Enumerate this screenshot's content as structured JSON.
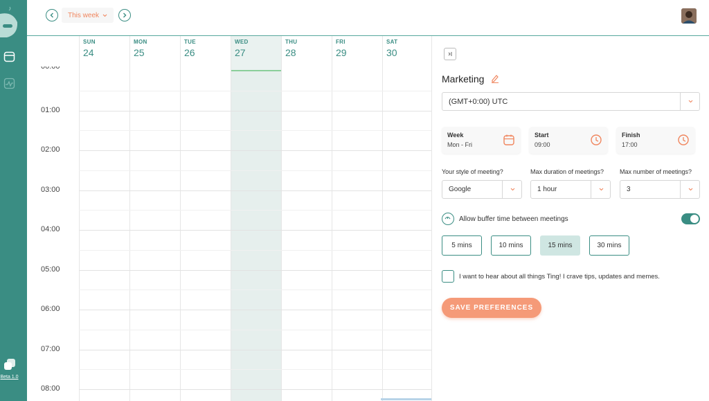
{
  "app": {
    "brand_color": "#3a8d83",
    "accent_color": "#f0855d",
    "version_label": "Beta 1.0"
  },
  "rail": {
    "icons": [
      "mascot-icon",
      "calendar-icon",
      "activity-icon",
      "ting-logo-icon"
    ]
  },
  "topbar": {
    "week_label": "This week",
    "prev_icon": "chevron-left-icon",
    "next_icon": "chevron-right-icon"
  },
  "calendar": {
    "days": [
      {
        "name": "SUN",
        "date": "24"
      },
      {
        "name": "MON",
        "date": "25"
      },
      {
        "name": "TUE",
        "date": "26"
      },
      {
        "name": "WED",
        "date": "27",
        "today": true
      },
      {
        "name": "THU",
        "date": "28"
      },
      {
        "name": "FRI",
        "date": "29"
      },
      {
        "name": "SAT",
        "date": "30"
      }
    ],
    "hours": [
      "00:00",
      "01:00",
      "02:00",
      "03:00",
      "04:00",
      "05:00",
      "06:00",
      "07:00",
      "08:00"
    ]
  },
  "panel": {
    "title": "Marketing",
    "timezone": "(GMT+0:00) UTC",
    "cards": [
      {
        "label": "Week",
        "value": "Mon - Fri",
        "icon": "calendar-icon"
      },
      {
        "label": "Start",
        "value": "09:00",
        "icon": "clock-icon"
      },
      {
        "label": "Finish",
        "value": "17:00",
        "icon": "clock-icon"
      }
    ],
    "fields": [
      {
        "label": "Your style of meeting?",
        "value": "Google"
      },
      {
        "label": "Max duration of meetings?",
        "value": "1 hour"
      },
      {
        "label": "Max number of meetings?",
        "value": "3"
      }
    ],
    "buffer_label": "Allow buffer time between meetings",
    "buffer_enabled": true,
    "buffer_options": [
      "5 mins",
      "10 mins",
      "15 mins",
      "30 mins"
    ],
    "buffer_selected": "15 mins",
    "newsletter_label": "I want to hear about all things Ting! I crave tips, updates and memes.",
    "newsletter_checked": false,
    "save_label": "SAVE PREFERENCES"
  }
}
